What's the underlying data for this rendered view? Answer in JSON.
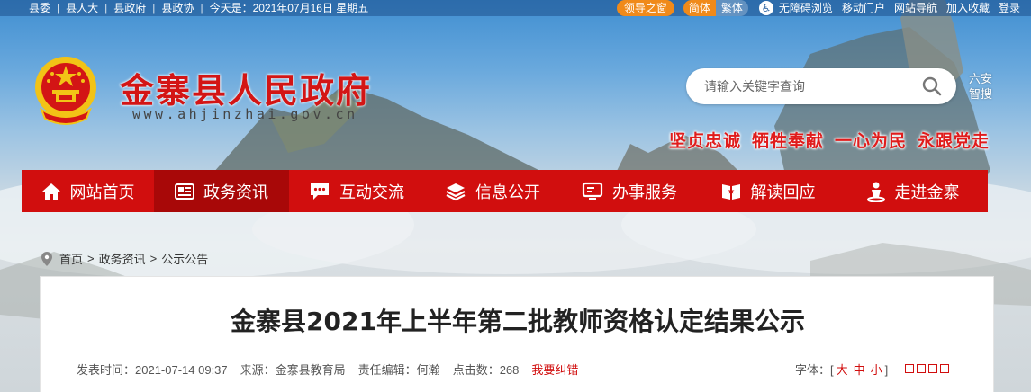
{
  "topbar": {
    "links": [
      "县委",
      "县人大",
      "县政府",
      "县政协"
    ],
    "today": "今天是：2021年07月16日 星期五",
    "leader_window": "领导之窗",
    "simplified": "简体",
    "traditional": "繁体",
    "accessible": "无障碍浏览",
    "mobile": "移动门户",
    "site_nav": "网站导航",
    "favorite": "加入收藏",
    "login": "登录"
  },
  "header": {
    "title": "金寨县人民政府",
    "url": "www.ahjinzhai.gov.cn",
    "search_placeholder": "请输入关键字查询",
    "smart_search_line1": "六安",
    "smart_search_line2": "智搜",
    "slogans": [
      "坚贞忠诚",
      "牺牲奉献",
      "一心为民",
      "永跟党走"
    ]
  },
  "nav": {
    "items": [
      {
        "label": "网站首页",
        "icon": "home-icon"
      },
      {
        "label": "政务资讯",
        "icon": "news-icon"
      },
      {
        "label": "互动交流",
        "icon": "chat-icon"
      },
      {
        "label": "信息公开",
        "icon": "layers-icon"
      },
      {
        "label": "办事服务",
        "icon": "monitor-icon"
      },
      {
        "label": "解读回应",
        "icon": "book-icon"
      },
      {
        "label": "走进金寨",
        "icon": "location-person-icon"
      }
    ],
    "active_index": 1
  },
  "breadcrumb": [
    "首页",
    "政务资讯",
    "公示公告"
  ],
  "article": {
    "title": "金寨县2021年上半年第二批教师资格认定结果公示",
    "publish_time": "发表时间：2021-07-14 09:37",
    "source": "来源：金寨县教育局",
    "editor": "责任编辑：何瀚",
    "clicks": "点击数：268",
    "report": "我要纠错",
    "font_label": "字体：[",
    "font_large": "大",
    "font_medium": "中",
    "font_small": "小",
    "font_close": "]"
  },
  "colors": {
    "brand_red": "#d10e0e",
    "nav_active": "#a80808",
    "accent_orange": "#f08a1a"
  }
}
